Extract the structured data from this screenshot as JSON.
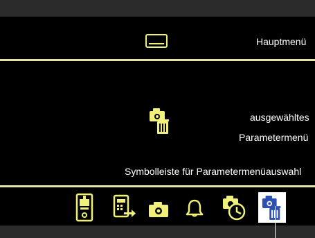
{
  "labels": {
    "main_menu": "Hauptmenü",
    "selected_line1": "ausgewähltes",
    "selected_line2": "Parametermenü",
    "toolbar_caption": "Symbolleiste für Parametermenüauswahl"
  },
  "colors": {
    "screen_bg": "#000000",
    "accent": "#F0F07A",
    "divider": "#E8E3A6",
    "selected_bg": "#FFFFFF",
    "selected_icon": "#2C4FB0",
    "frame": "#2B2B2B"
  },
  "icons": [
    "main-menu-icon",
    "selected-parameter-menu-icon",
    "welding-machine-icon",
    "device-transfer-icon",
    "camera-icon",
    "bell-icon",
    "clock-camera-icon",
    "trash-camera-icon"
  ]
}
